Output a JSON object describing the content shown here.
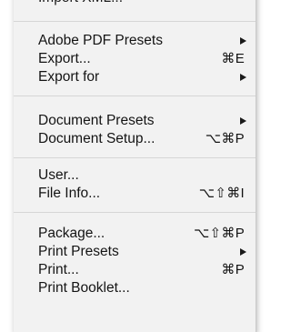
{
  "menu": {
    "top_clipped_label": "Import XML...",
    "groups": [
      {
        "items": [
          {
            "label": "Adobe PDF Presets",
            "shortcut": "",
            "submenu": true
          },
          {
            "label": "Export...",
            "shortcut": "⌘E",
            "submenu": false
          },
          {
            "label": "Export for",
            "shortcut": "",
            "submenu": true
          }
        ]
      },
      {
        "items": [
          {
            "label": "Document Presets",
            "shortcut": "",
            "submenu": true
          },
          {
            "label": "Document Setup...",
            "shortcut": "⌥⌘P",
            "submenu": false
          }
        ]
      },
      {
        "items": [
          {
            "label": "User...",
            "shortcut": "",
            "submenu": false
          },
          {
            "label": "File Info...",
            "shortcut": "⌥⇧⌘I",
            "submenu": false
          }
        ]
      },
      {
        "items": [
          {
            "label": "Package...",
            "shortcut": "⌥⇧⌘P",
            "submenu": false
          },
          {
            "label": "Print Presets",
            "shortcut": "",
            "submenu": true
          },
          {
            "label": "Print...",
            "shortcut": "⌘P",
            "submenu": false
          },
          {
            "label": "Print Booklet...",
            "shortcut": "",
            "submenu": false
          }
        ]
      }
    ]
  }
}
